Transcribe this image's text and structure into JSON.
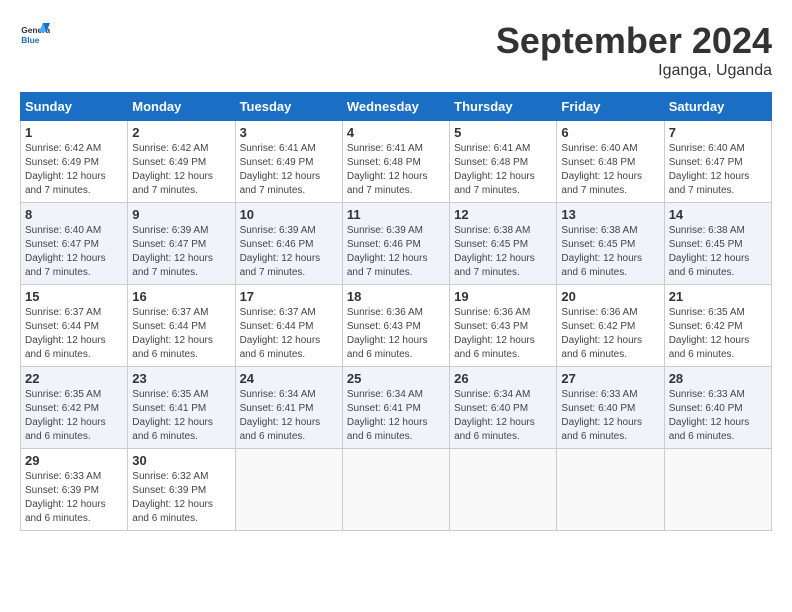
{
  "header": {
    "logo_general": "General",
    "logo_blue": "Blue",
    "month_title": "September 2024",
    "location": "Iganga, Uganda"
  },
  "weekdays": [
    "Sunday",
    "Monday",
    "Tuesday",
    "Wednesday",
    "Thursday",
    "Friday",
    "Saturday"
  ],
  "weeks": [
    [
      {
        "day": "1",
        "sunrise": "6:42 AM",
        "sunset": "6:49 PM",
        "daylight": "12 hours and 7 minutes."
      },
      {
        "day": "2",
        "sunrise": "6:42 AM",
        "sunset": "6:49 PM",
        "daylight": "12 hours and 7 minutes."
      },
      {
        "day": "3",
        "sunrise": "6:41 AM",
        "sunset": "6:49 PM",
        "daylight": "12 hours and 7 minutes."
      },
      {
        "day": "4",
        "sunrise": "6:41 AM",
        "sunset": "6:48 PM",
        "daylight": "12 hours and 7 minutes."
      },
      {
        "day": "5",
        "sunrise": "6:41 AM",
        "sunset": "6:48 PM",
        "daylight": "12 hours and 7 minutes."
      },
      {
        "day": "6",
        "sunrise": "6:40 AM",
        "sunset": "6:48 PM",
        "daylight": "12 hours and 7 minutes."
      },
      {
        "day": "7",
        "sunrise": "6:40 AM",
        "sunset": "6:47 PM",
        "daylight": "12 hours and 7 minutes."
      }
    ],
    [
      {
        "day": "8",
        "sunrise": "6:40 AM",
        "sunset": "6:47 PM",
        "daylight": "12 hours and 7 minutes."
      },
      {
        "day": "9",
        "sunrise": "6:39 AM",
        "sunset": "6:47 PM",
        "daylight": "12 hours and 7 minutes."
      },
      {
        "day": "10",
        "sunrise": "6:39 AM",
        "sunset": "6:46 PM",
        "daylight": "12 hours and 7 minutes."
      },
      {
        "day": "11",
        "sunrise": "6:39 AM",
        "sunset": "6:46 PM",
        "daylight": "12 hours and 7 minutes."
      },
      {
        "day": "12",
        "sunrise": "6:38 AM",
        "sunset": "6:45 PM",
        "daylight": "12 hours and 7 minutes."
      },
      {
        "day": "13",
        "sunrise": "6:38 AM",
        "sunset": "6:45 PM",
        "daylight": "12 hours and 6 minutes."
      },
      {
        "day": "14",
        "sunrise": "6:38 AM",
        "sunset": "6:45 PM",
        "daylight": "12 hours and 6 minutes."
      }
    ],
    [
      {
        "day": "15",
        "sunrise": "6:37 AM",
        "sunset": "6:44 PM",
        "daylight": "12 hours and 6 minutes."
      },
      {
        "day": "16",
        "sunrise": "6:37 AM",
        "sunset": "6:44 PM",
        "daylight": "12 hours and 6 minutes."
      },
      {
        "day": "17",
        "sunrise": "6:37 AM",
        "sunset": "6:44 PM",
        "daylight": "12 hours and 6 minutes."
      },
      {
        "day": "18",
        "sunrise": "6:36 AM",
        "sunset": "6:43 PM",
        "daylight": "12 hours and 6 minutes."
      },
      {
        "day": "19",
        "sunrise": "6:36 AM",
        "sunset": "6:43 PM",
        "daylight": "12 hours and 6 minutes."
      },
      {
        "day": "20",
        "sunrise": "6:36 AM",
        "sunset": "6:42 PM",
        "daylight": "12 hours and 6 minutes."
      },
      {
        "day": "21",
        "sunrise": "6:35 AM",
        "sunset": "6:42 PM",
        "daylight": "12 hours and 6 minutes."
      }
    ],
    [
      {
        "day": "22",
        "sunrise": "6:35 AM",
        "sunset": "6:42 PM",
        "daylight": "12 hours and 6 minutes."
      },
      {
        "day": "23",
        "sunrise": "6:35 AM",
        "sunset": "6:41 PM",
        "daylight": "12 hours and 6 minutes."
      },
      {
        "day": "24",
        "sunrise": "6:34 AM",
        "sunset": "6:41 PM",
        "daylight": "12 hours and 6 minutes."
      },
      {
        "day": "25",
        "sunrise": "6:34 AM",
        "sunset": "6:41 PM",
        "daylight": "12 hours and 6 minutes."
      },
      {
        "day": "26",
        "sunrise": "6:34 AM",
        "sunset": "6:40 PM",
        "daylight": "12 hours and 6 minutes."
      },
      {
        "day": "27",
        "sunrise": "6:33 AM",
        "sunset": "6:40 PM",
        "daylight": "12 hours and 6 minutes."
      },
      {
        "day": "28",
        "sunrise": "6:33 AM",
        "sunset": "6:40 PM",
        "daylight": "12 hours and 6 minutes."
      }
    ],
    [
      {
        "day": "29",
        "sunrise": "6:33 AM",
        "sunset": "6:39 PM",
        "daylight": "12 hours and 6 minutes."
      },
      {
        "day": "30",
        "sunrise": "6:32 AM",
        "sunset": "6:39 PM",
        "daylight": "12 hours and 6 minutes."
      },
      null,
      null,
      null,
      null,
      null
    ]
  ]
}
